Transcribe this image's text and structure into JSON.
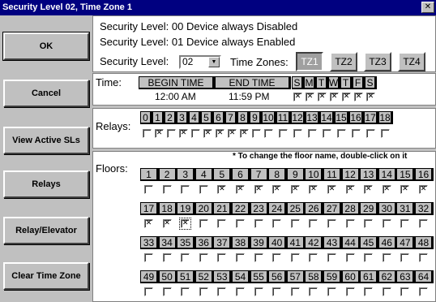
{
  "window": {
    "title": "Security Level 02, Time Zone 1",
    "close_glyph": "✕"
  },
  "buttons": [
    {
      "label": "OK",
      "name": "ok-button",
      "default": true
    },
    {
      "label": "Cancel",
      "name": "cancel-button"
    },
    {
      "label": "View Active SLs",
      "name": "view-active-sls-button"
    },
    {
      "label": "Relays",
      "name": "relays-button"
    },
    {
      "label": "Relay/Elevator",
      "name": "relay-elevator-button"
    },
    {
      "label": "Clear Time Zone",
      "name": "clear-time-zone-button"
    }
  ],
  "security": {
    "line0": "Security Level:  00 Device always Disabled",
    "line1": "Security Level:  01 Device always Enabled",
    "level_label": "Security Level:",
    "level_value": "02",
    "time_zones_label": "Time Zones:",
    "time_zones": [
      "TZ1",
      "TZ2",
      "TZ3",
      "TZ4"
    ],
    "active_time_zone": "TZ1"
  },
  "time": {
    "label": "Time:",
    "begin_header": "BEGIN TIME",
    "end_header": "END TIME",
    "begin_value": "12:00 AM",
    "end_value": "11:59 PM",
    "days": [
      "S",
      "M",
      "T",
      "W",
      "T",
      "F",
      "S"
    ],
    "days_checked": [
      true,
      true,
      true,
      true,
      true,
      true,
      true
    ]
  },
  "relays": {
    "label": "Relays:",
    "numbers": [
      "0",
      "1",
      "2",
      "3",
      "4",
      "5",
      "6",
      "7",
      "8",
      "9",
      "10",
      "11",
      "12",
      "13",
      "14",
      "15",
      "16",
      "17",
      "18"
    ],
    "checked": [
      false,
      true,
      false,
      true,
      false,
      true,
      true,
      true,
      true,
      false,
      false,
      false,
      false,
      false,
      false,
      false,
      false,
      false,
      false
    ]
  },
  "floors": {
    "label": "Floors:",
    "note": "* To change the floor name, double-click on it",
    "rows": [
      {
        "numbers": [
          "1",
          "2",
          "3",
          "4",
          "5",
          "6",
          "7",
          "8",
          "9",
          "10",
          "11",
          "12",
          "13",
          "14",
          "15",
          "16"
        ],
        "checked": [
          false,
          false,
          false,
          false,
          true,
          true,
          true,
          true,
          true,
          true,
          true,
          true,
          true,
          true,
          true,
          true
        ]
      },
      {
        "numbers": [
          "17",
          "18",
          "19",
          "20",
          "21",
          "22",
          "23",
          "24",
          "25",
          "26",
          "27",
          "28",
          "29",
          "30",
          "31",
          "32"
        ],
        "checked": [
          true,
          true,
          true,
          false,
          false,
          false,
          false,
          false,
          false,
          false,
          false,
          false,
          false,
          false,
          false,
          false
        ]
      },
      {
        "numbers": [
          "33",
          "34",
          "35",
          "36",
          "37",
          "38",
          "39",
          "40",
          "41",
          "42",
          "43",
          "44",
          "45",
          "46",
          "47",
          "48"
        ],
        "checked": [
          false,
          false,
          false,
          false,
          false,
          false,
          false,
          false,
          false,
          false,
          false,
          false,
          false,
          false,
          false,
          false
        ]
      },
      {
        "numbers": [
          "49",
          "50",
          "51",
          "52",
          "53",
          "54",
          "55",
          "56",
          "57",
          "58",
          "59",
          "60",
          "61",
          "62",
          "63",
          "64"
        ],
        "checked": [
          false,
          false,
          false,
          false,
          false,
          false,
          false,
          false,
          false,
          false,
          false,
          false,
          false,
          false,
          false,
          false
        ]
      }
    ]
  }
}
